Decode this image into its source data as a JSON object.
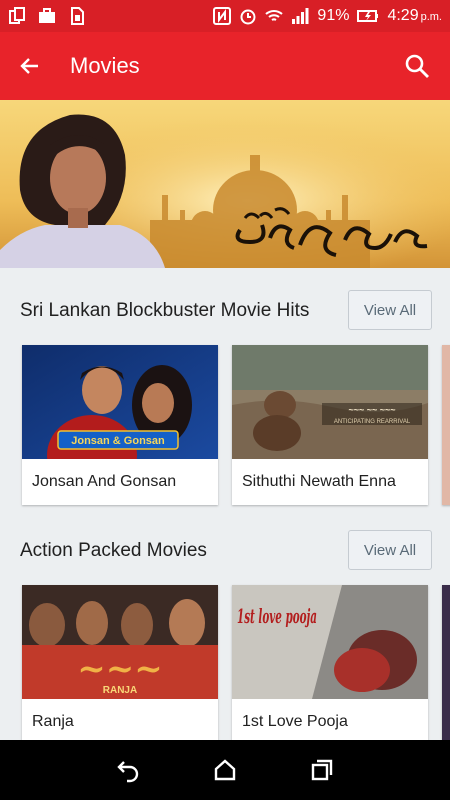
{
  "status_bar": {
    "battery": "91%",
    "time": "4:29",
    "ampm": "p.m.",
    "icons": [
      "copy-icon",
      "suitcase-icon",
      "sim-icon",
      "nfc-icon",
      "alarm-icon",
      "wifi-icon",
      "signal-icon",
      "battery-icon"
    ]
  },
  "app_bar": {
    "title": "Movies",
    "back_icon": "arrow-left-icon",
    "search_icon": "search-icon",
    "color": "#e8232a"
  },
  "sections": [
    {
      "title": "Sri Lankan Blockbuster Movie Hits",
      "view_all": "View All",
      "cards": [
        {
          "title": "Jonsan And Gonsan",
          "thumb_text": "Jonsan & Gonsan"
        },
        {
          "title": "Sithuthi Newath Enna",
          "thumb_text": "ANTICIPATING REARRIVAL"
        }
      ]
    },
    {
      "title": "Action Packed Movies",
      "view_all": "View All",
      "cards": [
        {
          "title": "Ranja",
          "thumb_text": "RANJA"
        },
        {
          "title": "1st Love Pooja",
          "thumb_text": "1st love pooja"
        }
      ]
    }
  ],
  "nav_bar": {
    "buttons": [
      "back-icon",
      "home-icon",
      "recents-icon"
    ]
  }
}
